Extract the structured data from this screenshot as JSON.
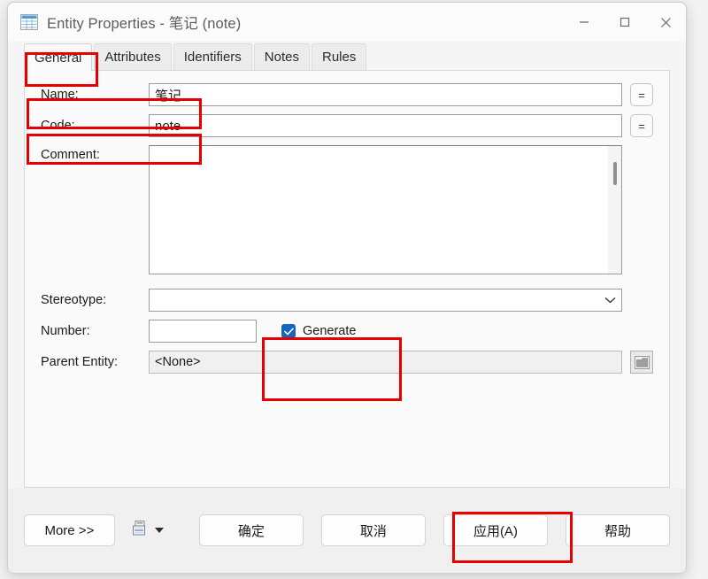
{
  "window": {
    "title": "Entity Properties - 笔记 (note)",
    "icon": "table-icon",
    "minimize_label": "–",
    "maximize_label": "□",
    "close_label": "✕"
  },
  "tabs": [
    {
      "label": "General",
      "active": true
    },
    {
      "label": "Attributes",
      "active": false
    },
    {
      "label": "Identifiers",
      "active": false
    },
    {
      "label": "Notes",
      "active": false
    },
    {
      "label": "Rules",
      "active": false
    }
  ],
  "form": {
    "name": {
      "label": "Name:",
      "value": "笔记",
      "side_button": "="
    },
    "code": {
      "label": "Code:",
      "value": "note",
      "side_button": "="
    },
    "comment": {
      "label": "Comment:",
      "value": ""
    },
    "stereotype": {
      "label": "Stereotype:",
      "value": "",
      "options": []
    },
    "number": {
      "label": "Number:",
      "value": ""
    },
    "generate": {
      "label": "Generate",
      "checked": true
    },
    "parent_entity": {
      "label": "Parent Entity:",
      "value": "<None>",
      "browse_button": "folder-icon"
    }
  },
  "footer": {
    "more_label": "More >>",
    "print_icon": "report-preview-icon",
    "print_dropdown": "chevron-down-icon",
    "ok_label": "确定",
    "cancel_label": "取消",
    "apply_label": "应用(A)",
    "help_label": "帮助"
  },
  "annotations": {
    "color": "#e60000",
    "targets": [
      "general-tab",
      "name-row",
      "code-row",
      "generate-checkbox",
      "apply-button"
    ]
  }
}
